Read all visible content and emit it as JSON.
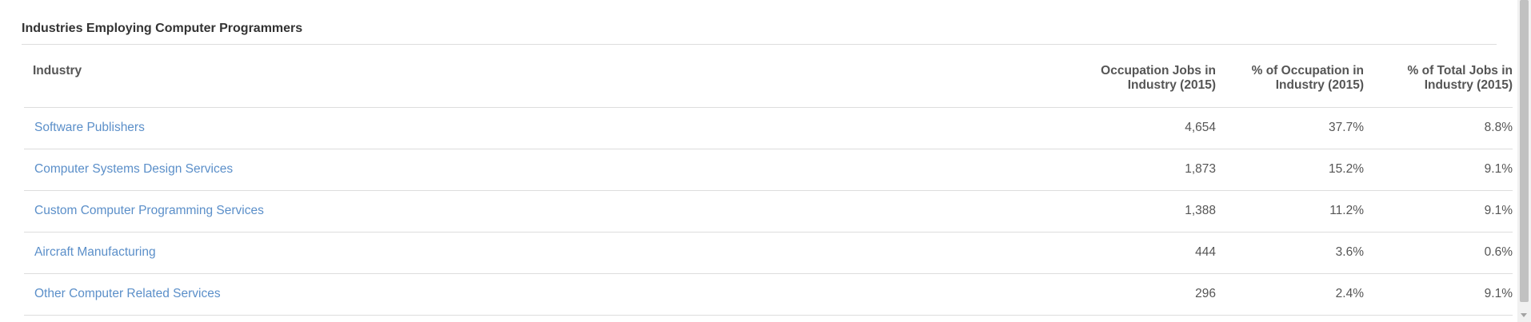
{
  "section": {
    "title": "Industries Employing Computer Programmers"
  },
  "table": {
    "headers": {
      "industry": "Industry",
      "jobs_line1": "Occupation Jobs in",
      "jobs_line2": "Industry (2015)",
      "occ_line1": "% of Occupation in",
      "occ_line2": "Industry (2015)",
      "total_line1": "% of Total Jobs in",
      "total_line2": "Industry (2015)"
    },
    "rows": [
      {
        "industry": "Software Publishers",
        "jobs": "4,654",
        "occ_pct": "37.7%",
        "total_pct": "8.8%"
      },
      {
        "industry": "Computer Systems Design Services",
        "jobs": "1,873",
        "occ_pct": "15.2%",
        "total_pct": "9.1%"
      },
      {
        "industry": "Custom Computer Programming Services",
        "jobs": "1,388",
        "occ_pct": "11.2%",
        "total_pct": "9.1%"
      },
      {
        "industry": "Aircraft Manufacturing",
        "jobs": "444",
        "occ_pct": "3.6%",
        "total_pct": "0.6%"
      },
      {
        "industry": "Other Computer Related Services",
        "jobs": "296",
        "occ_pct": "2.4%",
        "total_pct": "9.1%"
      }
    ]
  },
  "colors": {
    "link": "#5b8fc9",
    "text": "#555555",
    "heading": "#333333",
    "rule": "#dddddd"
  }
}
